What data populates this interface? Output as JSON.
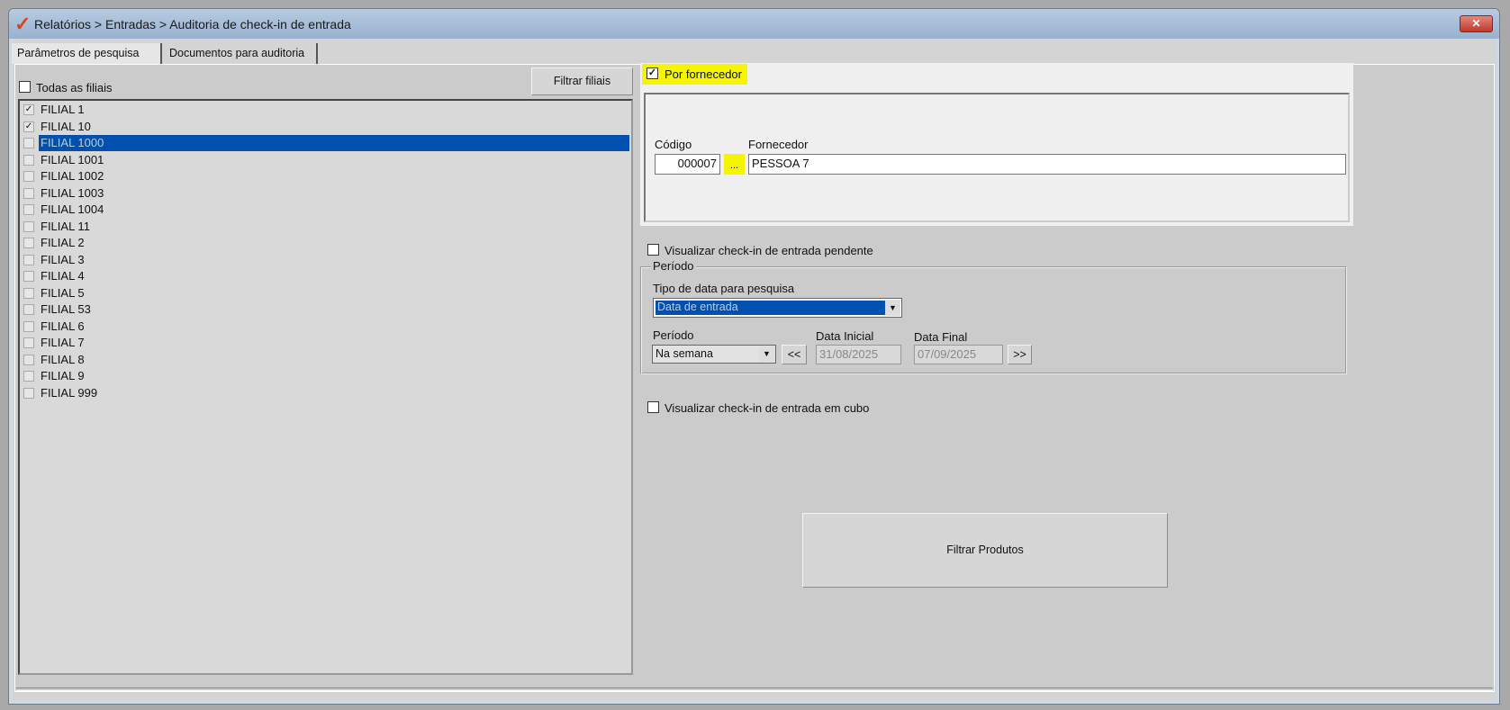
{
  "window": {
    "title": "Relatórios > Entradas > Auditoria de check-in de entrada",
    "close": "✕"
  },
  "tabs": [
    "Parâmetros de pesquisa",
    "Documentos para auditoria"
  ],
  "filiais": {
    "all_label": "Todas as filiais",
    "all_checked": false,
    "filter_button": "Filtrar filiais",
    "items": [
      {
        "label": "FILIAL 1",
        "checked": true
      },
      {
        "label": "FILIAL 10",
        "checked": true
      },
      {
        "label": "FILIAL 1000",
        "checked": false,
        "selected": true
      },
      {
        "label": "FILIAL 1001",
        "checked": false
      },
      {
        "label": "FILIAL 1002",
        "checked": false
      },
      {
        "label": "FILIAL 1003",
        "checked": false
      },
      {
        "label": "FILIAL 1004",
        "checked": false
      },
      {
        "label": "FILIAL 11",
        "checked": false
      },
      {
        "label": "FILIAL 2",
        "checked": false
      },
      {
        "label": "FILIAL 3",
        "checked": false
      },
      {
        "label": "FILIAL 4",
        "checked": false
      },
      {
        "label": "FILIAL 5",
        "checked": false
      },
      {
        "label": "FILIAL 53",
        "checked": false
      },
      {
        "label": "FILIAL 6",
        "checked": false
      },
      {
        "label": "FILIAL 7",
        "checked": false
      },
      {
        "label": "FILIAL 8",
        "checked": false
      },
      {
        "label": "FILIAL 9",
        "checked": false
      },
      {
        "label": "FILIAL 999",
        "checked": false
      }
    ]
  },
  "fornecedor": {
    "checkbox_label": "Por fornecedor",
    "checked": true,
    "codigo_label": "Código",
    "codigo_value": "000007",
    "lookup": "...",
    "fornecedor_label": "Fornecedor",
    "fornecedor_value": "PESSOA 7",
    "highlight": "#f5f500"
  },
  "pendente": {
    "label": "Visualizar check-in de entrada pendente",
    "checked": false
  },
  "periodo_group": {
    "title": "Período",
    "tipo_label": "Tipo de data para pesquisa",
    "tipo_value": "Data de entrada",
    "periodo_label": "Período",
    "periodo_value": "Na semana",
    "prev": "<<",
    "data_inicial_label": "Data Inicial",
    "data_inicial": "31/08/2025",
    "data_final_label": "Data Final",
    "data_final": "07/09/2025",
    "next": ">>"
  },
  "cubo": {
    "label": "Visualizar check-in de entrada em cubo",
    "checked": false
  },
  "filtrar_produtos": "Filtrar Produtos"
}
